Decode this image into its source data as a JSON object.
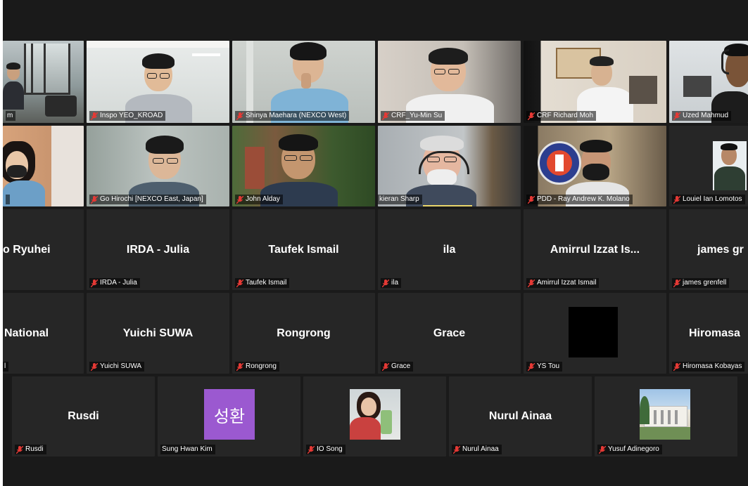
{
  "participants": [
    {
      "id": "p0",
      "label": "m",
      "type": "video",
      "active": true
    },
    {
      "id": "p1",
      "label": "Inspo YEO_KROAD",
      "type": "video"
    },
    {
      "id": "p2",
      "label": "Shinya Maehara (NEXCO West)",
      "type": "video"
    },
    {
      "id": "p3",
      "label": "CRF_Yu-Min Su",
      "type": "video"
    },
    {
      "id": "p4",
      "label": "CRF Richard Moh",
      "type": "video"
    },
    {
      "id": "p5",
      "label": "Uzed Mahmud",
      "type": "video"
    },
    {
      "id": "p6",
      "label": "",
      "type": "video"
    },
    {
      "id": "p7",
      "label": "Go Hirochi [NEXCO East, Japan]",
      "type": "video"
    },
    {
      "id": "p8",
      "label": "John Alday",
      "type": "video"
    },
    {
      "id": "p9",
      "label": "kieran Sharp",
      "type": "video"
    },
    {
      "id": "p10",
      "label": "PDD - Ray Andrew K. Molano",
      "type": "video"
    },
    {
      "id": "p11",
      "label": "Louiel Ian Lomotos",
      "type": "photo"
    },
    {
      "id": "p12",
      "big": "o Ryuhei",
      "label": "",
      "type": "name"
    },
    {
      "id": "p13",
      "big": "IRDA - Julia",
      "label": "IRDA - Julia",
      "type": "name"
    },
    {
      "id": "p14",
      "big": "Taufek Ismail",
      "label": "Taufek Ismail",
      "type": "name"
    },
    {
      "id": "p15",
      "big": "ila",
      "label": "ila",
      "type": "name"
    },
    {
      "id": "p16",
      "big": "Amirrul Izzat Is...",
      "label": "Amirrul Izzat Ismail",
      "type": "name"
    },
    {
      "id": "p17",
      "big": "james gr",
      "label": "james grenfell",
      "type": "name"
    },
    {
      "id": "p18",
      "big": "National",
      "label": "l",
      "type": "name"
    },
    {
      "id": "p19",
      "big": "Yuichi SUWA",
      "label": "Yuichi SUWA",
      "type": "name"
    },
    {
      "id": "p20",
      "big": "Rongrong",
      "label": "Rongrong",
      "type": "name"
    },
    {
      "id": "p21",
      "big": "Grace",
      "label": "Grace",
      "type": "name"
    },
    {
      "id": "p22",
      "big": "",
      "label": "YS Tou",
      "type": "blank"
    },
    {
      "id": "p23",
      "big": "Hiromasa",
      "label": "Hiromasa Kobayas",
      "type": "name"
    },
    {
      "id": "p24",
      "big": "Rusdi",
      "label": "Rusdi",
      "type": "name"
    },
    {
      "id": "p25",
      "avatar_text": "성환",
      "label": "Sung Hwan Kim",
      "type": "avatar",
      "avatar_color": "#9b59d0"
    },
    {
      "id": "p26",
      "label": "IO Song",
      "type": "photo"
    },
    {
      "id": "p27",
      "big": "Nurul Ainaa",
      "label": "Nurul Ainaa",
      "type": "name"
    },
    {
      "id": "p28",
      "label": "Yusuf Adinegoro",
      "type": "photo"
    }
  ],
  "colors": {
    "background": "#1a1a1a",
    "tile": "#262626",
    "active_border": "#c7d24a",
    "muted_mic": "#e53935",
    "avatar_purple": "#9b59d0"
  }
}
